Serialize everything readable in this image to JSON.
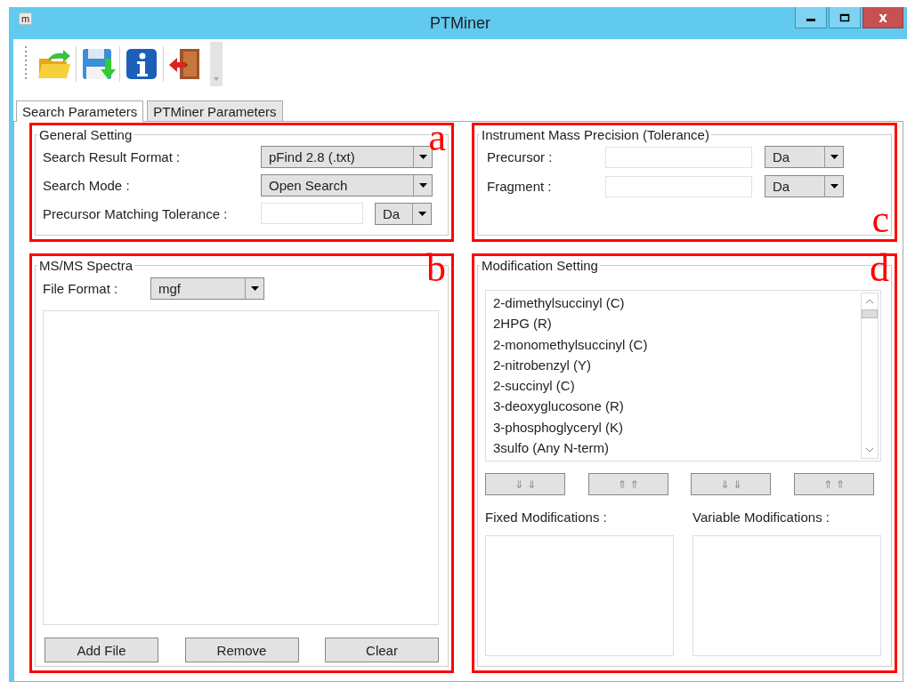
{
  "window": {
    "title": "PTMiner",
    "app_icon": "m",
    "close_glyph": "x"
  },
  "tabs": [
    {
      "label": "Search Parameters",
      "selected": true
    },
    {
      "label": "PTMiner Parameters",
      "selected": false
    }
  ],
  "general_setting": {
    "title": "General Setting",
    "annotation": "a",
    "rows": [
      {
        "kind": "combo",
        "label": "Search Result Format :",
        "value": "pFind 2.8 (.txt)"
      },
      {
        "kind": "combo",
        "label": "Search Mode :",
        "value": "Open Search"
      },
      {
        "kind": "field_combo",
        "label": "Precursor Matching Tolerance :",
        "unit": "Da"
      }
    ]
  },
  "instrument_mass_precision": {
    "title": "Instrument Mass Precision (Tolerance)",
    "annotation": "c",
    "rows": [
      {
        "kind": "field_combo",
        "label": "Precursor :",
        "unit": "Da"
      },
      {
        "kind": "field_combo",
        "label": "Fragment :",
        "unit": "Da"
      }
    ]
  },
  "ms_ms_spectra": {
    "title": "MS/MS Spectra",
    "annotation": "b",
    "file_format": {
      "label": "File Format :",
      "value": "mgf"
    },
    "buttons": [
      "Add File",
      "Remove",
      "Clear"
    ]
  },
  "modification_setting": {
    "title": "Modification Setting",
    "annotation": "d",
    "modifications": [
      "2-dimethylsuccinyl (C)",
      "2HPG (R)",
      "2-monomethylsuccinyl (C)",
      "2-nitrobenzyl (Y)",
      "2-succinyl (C)",
      "3-deoxyglucosone (R)",
      "3-phosphoglyceryl (K)",
      "3sulfo (Any N-term)"
    ],
    "move_buttons": [
      "⇓ ⇓",
      "⇑ ⇑",
      "⇓ ⇓",
      "⇑ ⇑"
    ],
    "fixed_label": "Fixed Modifications :",
    "variable_label": "Variable Modifications :"
  }
}
